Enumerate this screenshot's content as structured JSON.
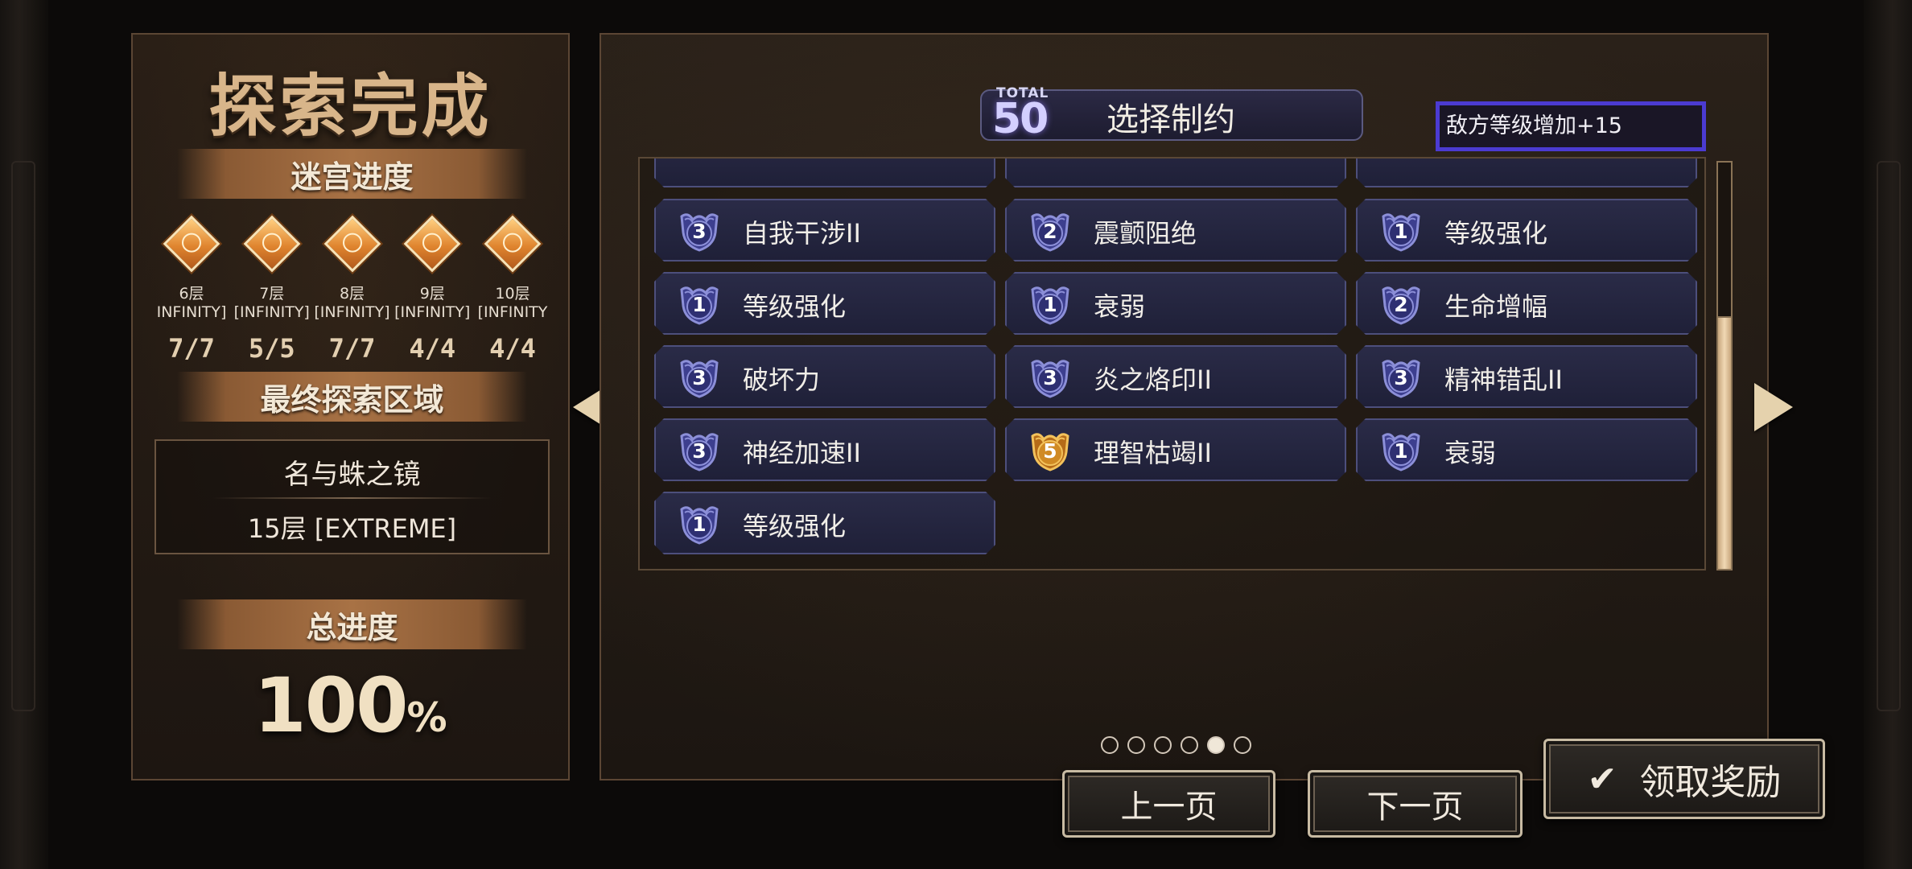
{
  "left_panel": {
    "title": "探索完成",
    "labyrinth_label": "迷宫进度",
    "floors": [
      {
        "name": "6层",
        "mode": "INFINITY]",
        "count": "7/7"
      },
      {
        "name": "7层",
        "mode": "[INFINITY]",
        "count": "5/5"
      },
      {
        "name": "8层",
        "mode": "[INFINITY]",
        "count": "7/7"
      },
      {
        "name": "9层",
        "mode": "[INFINITY]",
        "count": "4/4"
      },
      {
        "name": "10层",
        "mode": "[INFINITY",
        "count": "4/4"
      }
    ],
    "final_area_label": "最终探索区域",
    "final_area_name": "名与蛛之镜",
    "final_area_floor": "15层 [EXTREME]",
    "total_progress_label": "总进度",
    "total_progress_value": "100",
    "total_progress_unit": "%"
  },
  "header": {
    "total_label": "TOTAL",
    "total_value": "50",
    "title": "选择制约"
  },
  "effect_tooltip": "敌方等级增加+15",
  "restrictions": [
    {
      "level": "3",
      "label": "自我干涉II",
      "color": "blue"
    },
    {
      "level": "2",
      "label": "震颤阻绝",
      "color": "blue"
    },
    {
      "level": "1",
      "label": "等级强化",
      "color": "blue"
    },
    {
      "level": "1",
      "label": "等级强化",
      "color": "blue"
    },
    {
      "level": "1",
      "label": "衰弱",
      "color": "blue"
    },
    {
      "level": "2",
      "label": "生命增幅",
      "color": "blue"
    },
    {
      "level": "3",
      "label": "破坏力",
      "color": "blue"
    },
    {
      "level": "3",
      "label": "炎之烙印II",
      "color": "blue"
    },
    {
      "level": "3",
      "label": "精神错乱II",
      "color": "blue"
    },
    {
      "level": "3",
      "label": "神经加速II",
      "color": "blue"
    },
    {
      "level": "5",
      "label": "理智枯竭II",
      "color": "gold"
    },
    {
      "level": "1",
      "label": "衰弱",
      "color": "blue"
    },
    {
      "level": "1",
      "label": "等级强化",
      "color": "blue"
    }
  ],
  "pagination": {
    "total": 6,
    "current": 5
  },
  "buttons": {
    "prev": "上一页",
    "next": "下一页",
    "claim": "领取奖励"
  },
  "colors": {
    "accent_blue": "#4b3bd1",
    "card_bg": "#2a2b47",
    "gold_badge": "#e8a93a"
  }
}
